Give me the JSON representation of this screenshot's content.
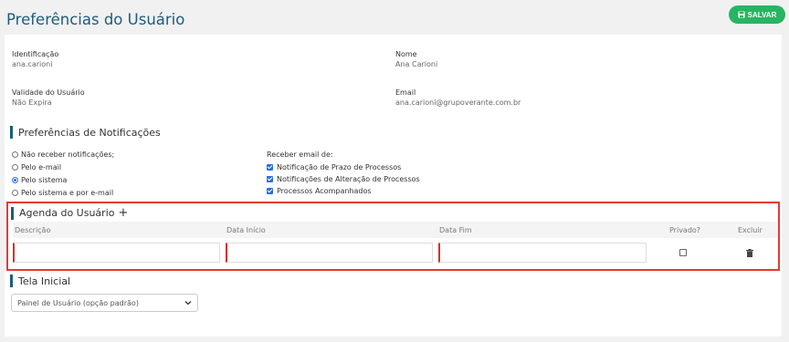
{
  "page": {
    "title": "Preferências do Usuário"
  },
  "toolbar": {
    "save_label": "SALVAR"
  },
  "user": {
    "identificacao_label": "Identificação",
    "identificacao_value": "ana.carioni",
    "nome_label": "Nome",
    "nome_value": "Ana Carioni",
    "validade_label": "Validade do Usuário",
    "validade_value": "Não Expira",
    "email_label": "Email",
    "email_value": "ana.carioni@grupoverante.com.br"
  },
  "notifications": {
    "title": "Preferências de Notificações",
    "options": [
      {
        "label": "Não receber notificações;",
        "selected": false
      },
      {
        "label": "Pelo e-mail",
        "selected": false
      },
      {
        "label": "Pelo sistema",
        "selected": true
      },
      {
        "label": "Pelo sistema e por e-mail",
        "selected": false
      }
    ],
    "receive_label": "Receber email de:",
    "receive_items": [
      {
        "label": "Notificação de Prazo de Processos",
        "checked": true
      },
      {
        "label": "Notificações de Alteração de Processos",
        "checked": true
      },
      {
        "label": "Processos Acompanhados",
        "checked": true
      }
    ]
  },
  "agenda": {
    "title": "Agenda do Usuário",
    "add_symbol": "+",
    "columns": {
      "descricao": "Descrição",
      "inicio": "Data Início",
      "fim": "Data Fim",
      "privado": "Privado?",
      "excluir": "Excluir"
    }
  },
  "tela_inicial": {
    "title": "Tela Inicial",
    "selected": "Painel de Usuário (opção padrão)"
  },
  "colors": {
    "accent": "#1d5c80",
    "save": "#28b463",
    "highlight": "#e53935",
    "check": "#2e6fd8"
  }
}
